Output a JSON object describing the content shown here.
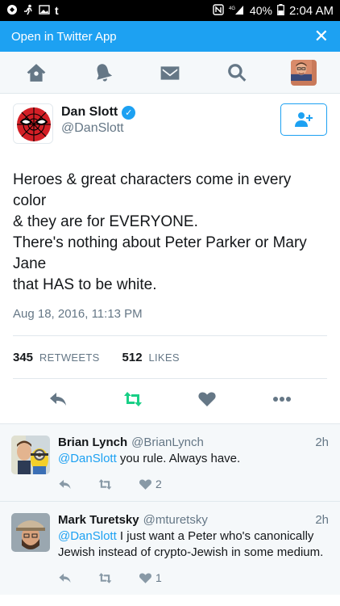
{
  "status_bar": {
    "left_icons": [
      "mirror-icon",
      "running-icon",
      "image-icon",
      "twitter-t-icon"
    ],
    "battery": "40%",
    "time": "2:04 AM"
  },
  "banner": {
    "label": "Open in Twitter App",
    "close_glyph": "✕"
  },
  "nav": {
    "items": [
      "home-icon",
      "notifications-icon",
      "messages-icon",
      "search-icon",
      "profile-avatar"
    ]
  },
  "tweet": {
    "author_name": "Dan Slott",
    "author_handle": "@DanSlott",
    "verified": true,
    "text_lines": [
      "Heroes & great characters come in every",
      "color",
      "& they are for EVERYONE.",
      "There's nothing about Peter Parker or Mary",
      "Jane",
      "that HAS to be white."
    ],
    "timestamp": "Aug 18, 2016, 11:13 PM",
    "retweets_count": "345",
    "retweets_label": "RETWEETS",
    "likes_count": "512",
    "likes_label": "LIKES"
  },
  "colors": {
    "brand": "#1da1f2",
    "retweet_green": "#19cf86",
    "muted": "#657786",
    "icon_gray": "#8899a6"
  },
  "replies": [
    {
      "name": "Brian Lynch",
      "handle": "@BrianLynch",
      "time": "2h",
      "mention": "@DanSlott",
      "text": " you rule. Always have.",
      "likes": "2"
    },
    {
      "name": "Mark Turetsky",
      "handle": "@mturetsky",
      "time": "2h",
      "mention": "@DanSlott",
      "text": " I just want a Peter who's canonically Jewish instead of crypto-Jewish in some medium.",
      "likes": "1"
    }
  ]
}
